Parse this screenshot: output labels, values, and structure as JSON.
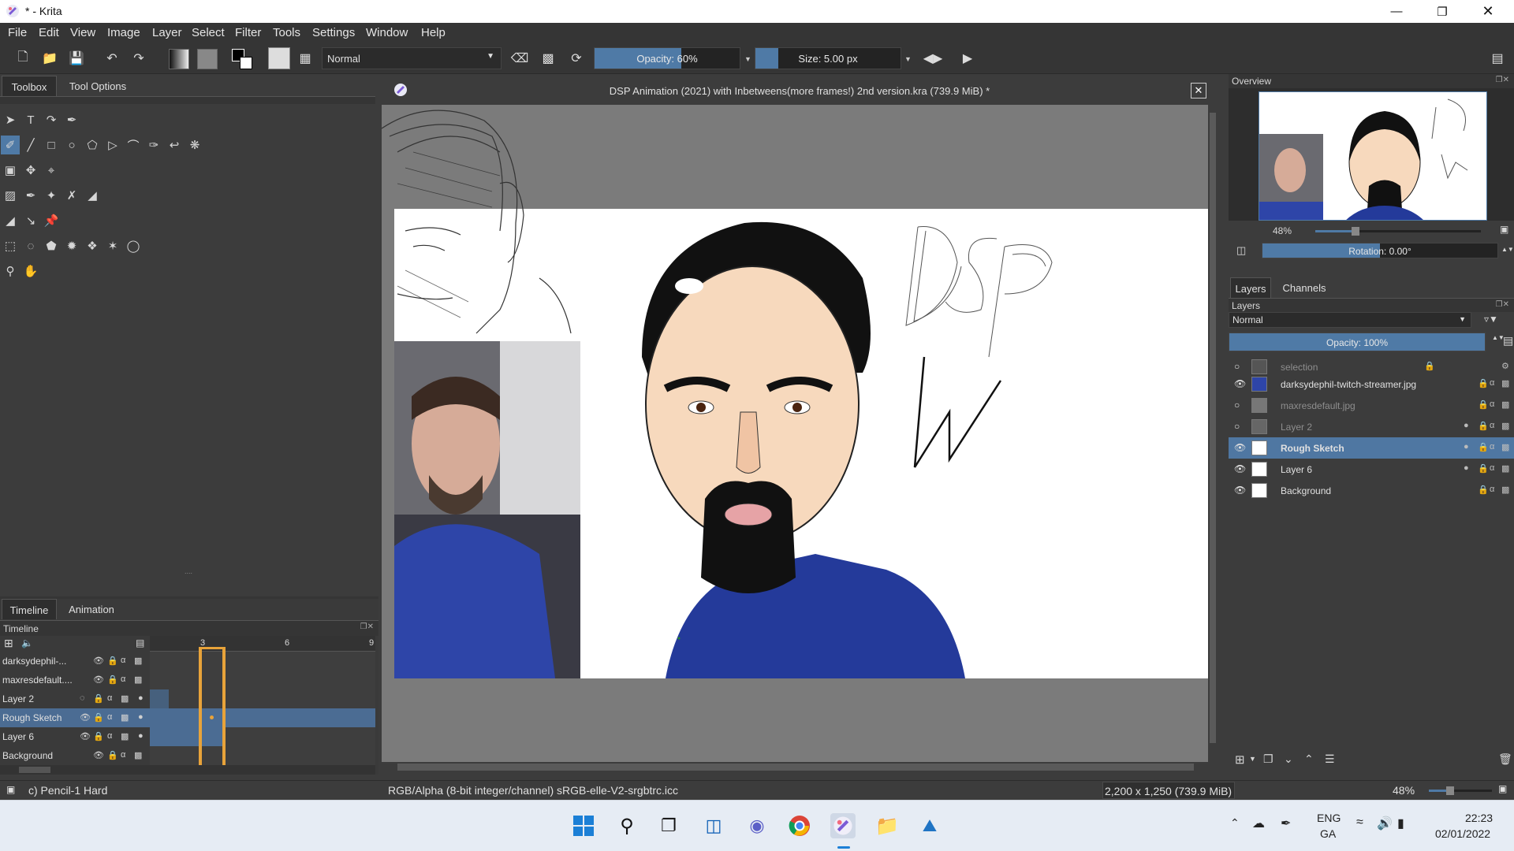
{
  "window": {
    "title": "* - Krita"
  },
  "menu": [
    "File",
    "Edit",
    "View",
    "Image",
    "Layer",
    "Select",
    "Filter",
    "Tools",
    "Settings",
    "Window",
    "Help"
  ],
  "toolbar": {
    "blend_mode": "Normal",
    "opacity_label": "Opacity: 60%",
    "opacity_value": 0.6,
    "size_label": "Size: 5.00 px"
  },
  "left_dock": {
    "tabs": [
      "Toolbox",
      "Tool Options"
    ]
  },
  "timeline": {
    "tabs": [
      "Timeline",
      "Animation"
    ],
    "header": "Timeline",
    "frame_numbers": [
      "3",
      "6",
      "9"
    ],
    "current_frame": 3,
    "layers": [
      {
        "name": "darksydephil-..."
      },
      {
        "name": "maxresdefault...."
      },
      {
        "name": "Layer 2"
      },
      {
        "name": "Rough Sketch"
      },
      {
        "name": "Layer 6"
      },
      {
        "name": "Background"
      }
    ]
  },
  "document": {
    "title": "DSP Animation (2021) with Inbetweens(more frames!) 2nd version.kra (739.9 MiB) *"
  },
  "overview": {
    "header": "Overview",
    "zoom": "48%",
    "rotation_label": "Rotation: 0.00°"
  },
  "layers_panel": {
    "tabs": [
      "Layers",
      "Channels"
    ],
    "header": "Layers",
    "blend_mode": "Normal",
    "opacity_label": "Opacity:  100%",
    "layers": [
      {
        "name": "selection"
      },
      {
        "name": "darksydephil-twitch-streamer.jpg"
      },
      {
        "name": "maxresdefault.jpg"
      },
      {
        "name": "Layer 2"
      },
      {
        "name": "Rough Sketch"
      },
      {
        "name": "Layer 6"
      },
      {
        "name": "Background"
      }
    ]
  },
  "status": {
    "brush": "c) Pencil-1 Hard",
    "color_profile": "RGB/Alpha (8-bit integer/channel)  sRGB-elle-V2-srgbtrc.icc",
    "dimensions": "2,200 x 1,250 (739.9 MiB)",
    "zoom": "48%"
  },
  "taskbar": {
    "language": "ENG",
    "region": "GA",
    "time": "22:23",
    "date": "02/01/2022"
  },
  "colors": {
    "accent": "#4f7aa6",
    "selection": "#4b6c93",
    "frame_cursor": "#e8a33a"
  }
}
